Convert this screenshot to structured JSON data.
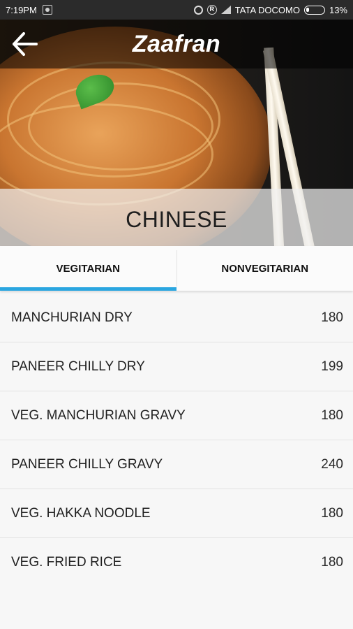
{
  "status_bar": {
    "time": "7:19PM",
    "carrier": "TATA DOCOMO",
    "battery": "13%"
  },
  "app_bar": {
    "title": "Zaafran",
    "back_icon": "arrow-left-icon"
  },
  "category": "CHINESE",
  "tabs": [
    {
      "label": "VEGITARIAN",
      "active": true
    },
    {
      "label": "NONVEGITARIAN",
      "active": false
    }
  ],
  "menu_items": [
    {
      "name": "MANCHURIAN DRY",
      "price": "180"
    },
    {
      "name": "PANEER CHILLY DRY",
      "price": "199"
    },
    {
      "name": "VEG. MANCHURIAN GRAVY",
      "price": "180"
    },
    {
      "name": "PANEER CHILLY GRAVY",
      "price": "240"
    },
    {
      "name": "VEG. HAKKA NOODLE",
      "price": "180"
    },
    {
      "name": "VEG. FRIED RICE",
      "price": "180"
    }
  ],
  "colors": {
    "accent": "#2aa6e0",
    "status_bar": "#2b2b2b"
  }
}
